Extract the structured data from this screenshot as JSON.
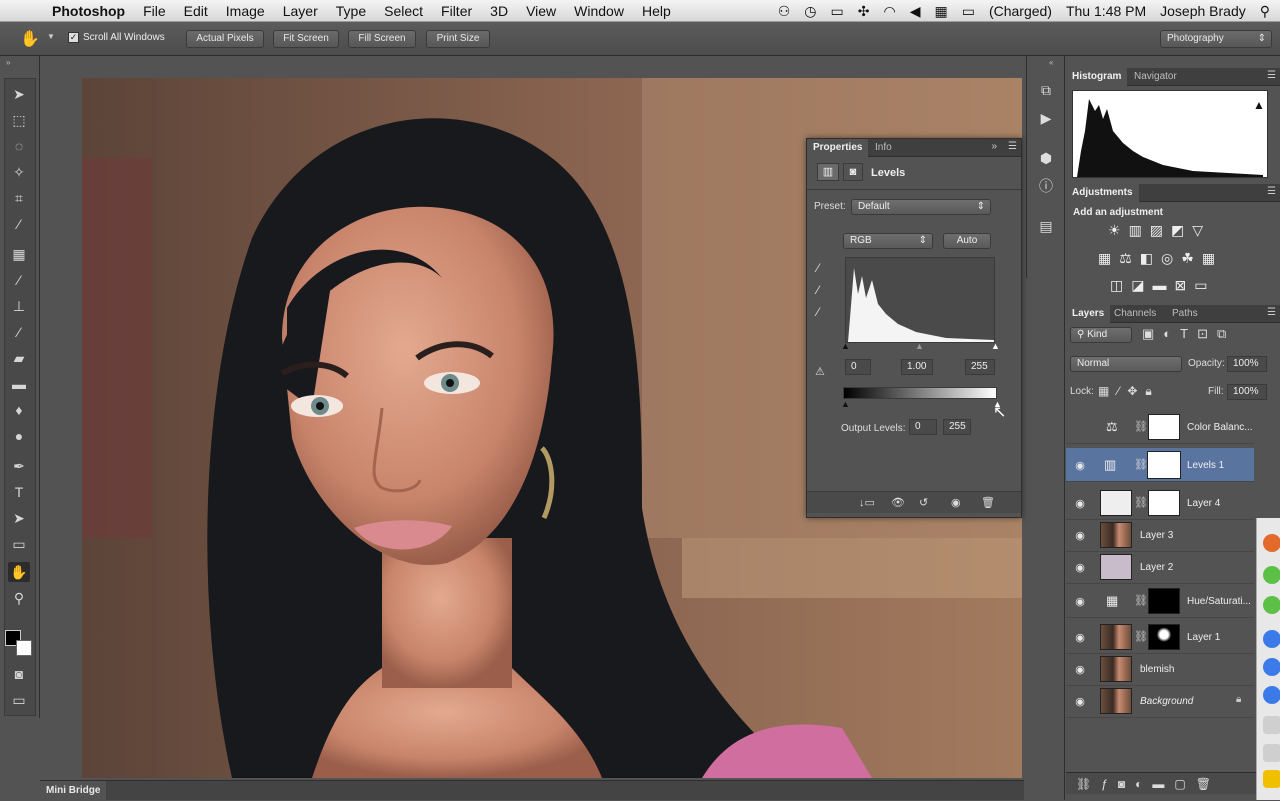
{
  "menubar": {
    "app": "Photoshop",
    "items": [
      "File",
      "Edit",
      "Image",
      "Layer",
      "Type",
      "Select",
      "Filter",
      "3D",
      "View",
      "Window",
      "Help"
    ],
    "battery": "(Charged)",
    "clock": "Thu 1:48 PM",
    "user": "Joseph Brady"
  },
  "optionsbar": {
    "scroll_all": "Scroll All Windows",
    "actual_pixels": "Actual Pixels",
    "fit_screen": "Fit Screen",
    "fill_screen": "Fill Screen",
    "print_size": "Print Size",
    "workspace": "Photography"
  },
  "minibridge": {
    "label": "Mini Bridge"
  },
  "histogram": {
    "tab_active": "Histogram",
    "tab2": "Navigator"
  },
  "adjustments": {
    "tab": "Adjustments",
    "title": "Add an adjustment"
  },
  "properties": {
    "tab_active": "Properties",
    "tab2": "Info",
    "title": "Levels",
    "preset_label": "Preset:",
    "preset_value": "Default",
    "channel": "RGB",
    "auto": "Auto",
    "input_black": "0",
    "input_gamma": "1.00",
    "input_white": "255",
    "output_label": "Output Levels:",
    "output_black": "0",
    "output_white": "255"
  },
  "layers_panel": {
    "tabs": [
      "Layers",
      "Channels",
      "Paths"
    ],
    "kind": "Kind",
    "blend_mode": "Normal",
    "opacity_label": "Opacity:",
    "opacity": "100%",
    "lock_label": "Lock:",
    "fill_label": "Fill:",
    "fill": "100%",
    "layers": [
      {
        "name": "Color Balanc...",
        "visible": false
      },
      {
        "name": "Levels 1",
        "visible": true,
        "selected": true
      },
      {
        "name": "Layer 4",
        "visible": true
      },
      {
        "name": "Layer 3",
        "visible": true
      },
      {
        "name": "Layer 2",
        "visible": true
      },
      {
        "name": "Hue/Saturati...",
        "visible": true
      },
      {
        "name": "Layer 1",
        "visible": true
      },
      {
        "name": "blemish",
        "visible": true
      },
      {
        "name": "Background",
        "visible": true
      }
    ]
  },
  "colors": {
    "selection": "#5a74a0",
    "panel": "#535353",
    "chrome": "#3f3f3f"
  }
}
